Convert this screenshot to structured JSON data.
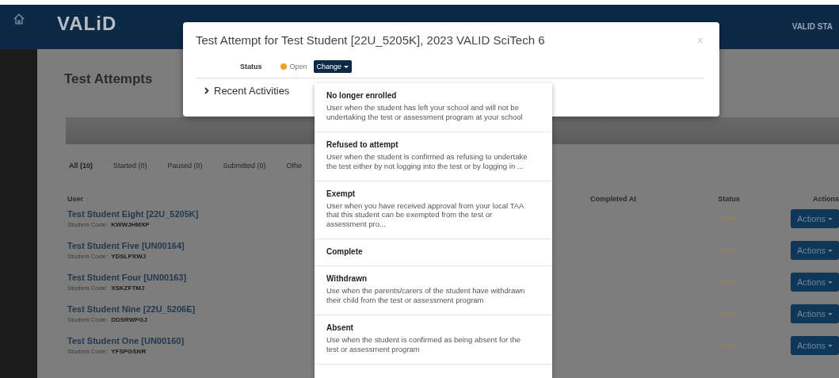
{
  "header": {
    "logo": "VALiD",
    "user_menu": "VALID STA"
  },
  "page": {
    "title": "Test Attempts",
    "tabs": [
      {
        "label": "All (10)",
        "selected": true
      },
      {
        "label": "Started (0)",
        "selected": false
      },
      {
        "label": "Paused (0)",
        "selected": false
      },
      {
        "label": "Submitted (0)",
        "selected": false
      },
      {
        "label": "Othe",
        "selected": false
      }
    ],
    "table": {
      "columns": [
        "User",
        "Completed At",
        "Status",
        "Actions"
      ],
      "rows": [
        {
          "name": "Test Student Eight [22U_5205K]",
          "code_label": "Student Code:",
          "code": "KWWJHMXP",
          "action": "Actions"
        },
        {
          "name": "Test Student Five [UN00164]",
          "code_label": "Student Code:",
          "code": "YDSLPXWJ",
          "action": "Actions"
        },
        {
          "name": "Test Student Four [UN00163]",
          "code_label": "Student Code:",
          "code": "XSKZFTMJ",
          "action": "Actions"
        },
        {
          "name": "Test Student Nine [22U_5206E]",
          "code_label": "Student Code:",
          "code": "DDSRWFGJ",
          "action": "Actions"
        },
        {
          "name": "Test Student One [UN00160]",
          "code_label": "Student Code:",
          "code": "YFSPGSNR",
          "action": "Actions"
        }
      ]
    }
  },
  "modal": {
    "title": "Test Attempt for Test Student [22U_5205K], 2023 VALID SciTech 6",
    "close": "×",
    "status_label": "Status",
    "status_value": "Open",
    "change_button": "Change",
    "recent_activities": "Recent Activities"
  },
  "status_menu": {
    "items": [
      {
        "title": "No longer enrolled",
        "description": "User when the student has left your school and will not be undertaking the test or assessment program at your school"
      },
      {
        "title": "Refused to attempt",
        "description": "User when the student is confirmed as refusing to undertake the test either by not logging into the test or by logging in ..."
      },
      {
        "title": "Exempt",
        "description": "User when you have received approval from your local TAA that this student can be exempted from the test or assessment pro..."
      },
      {
        "title": "Complete"
      },
      {
        "title": "Withdrawn",
        "description": "Use when the parents/carers of the student have withdrawn their child from the test or assessment program"
      },
      {
        "title": "Absent",
        "description": "Use when the student is confirmed as being absent for the test or assessment program"
      }
    ]
  }
}
